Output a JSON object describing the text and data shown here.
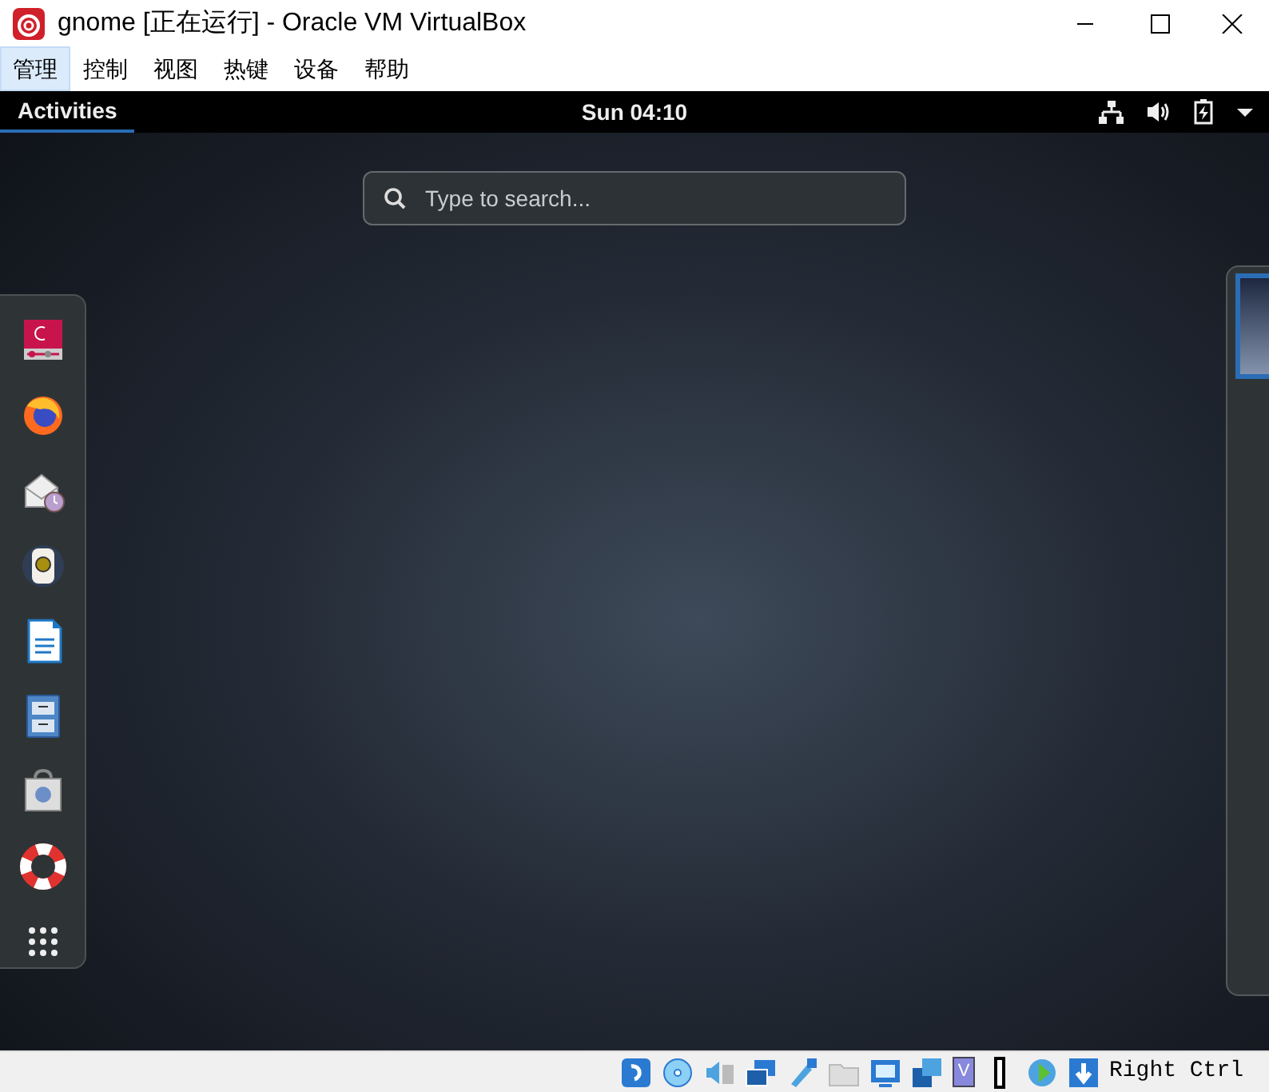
{
  "window": {
    "title": "gnome [正在运行] - Oracle VM VirtualBox"
  },
  "menu": [
    {
      "label": "管理",
      "selected": true
    },
    {
      "label": "控制",
      "selected": false
    },
    {
      "label": "视图",
      "selected": false
    },
    {
      "label": "热键",
      "selected": false
    },
    {
      "label": "设备",
      "selected": false
    },
    {
      "label": "帮助",
      "selected": false
    }
  ],
  "top_bar": {
    "activities": {
      "label": "Activities",
      "selected": true
    },
    "clock": "Sun 04:10"
  },
  "search": {
    "placeholder": "Type to search..."
  },
  "dash": {
    "items": [
      {
        "kind": "installer"
      },
      {
        "kind": "browser"
      },
      {
        "kind": "mail"
      },
      {
        "kind": "speaker"
      },
      {
        "kind": "document"
      },
      {
        "kind": "cabinet"
      },
      {
        "kind": "store"
      },
      {
        "kind": "help"
      },
      {
        "kind": "apps"
      }
    ]
  },
  "workspaces": [
    {
      "selected": true
    }
  ],
  "status_bar": {
    "vt_badge": "V",
    "host_key": "Right Ctrl"
  }
}
